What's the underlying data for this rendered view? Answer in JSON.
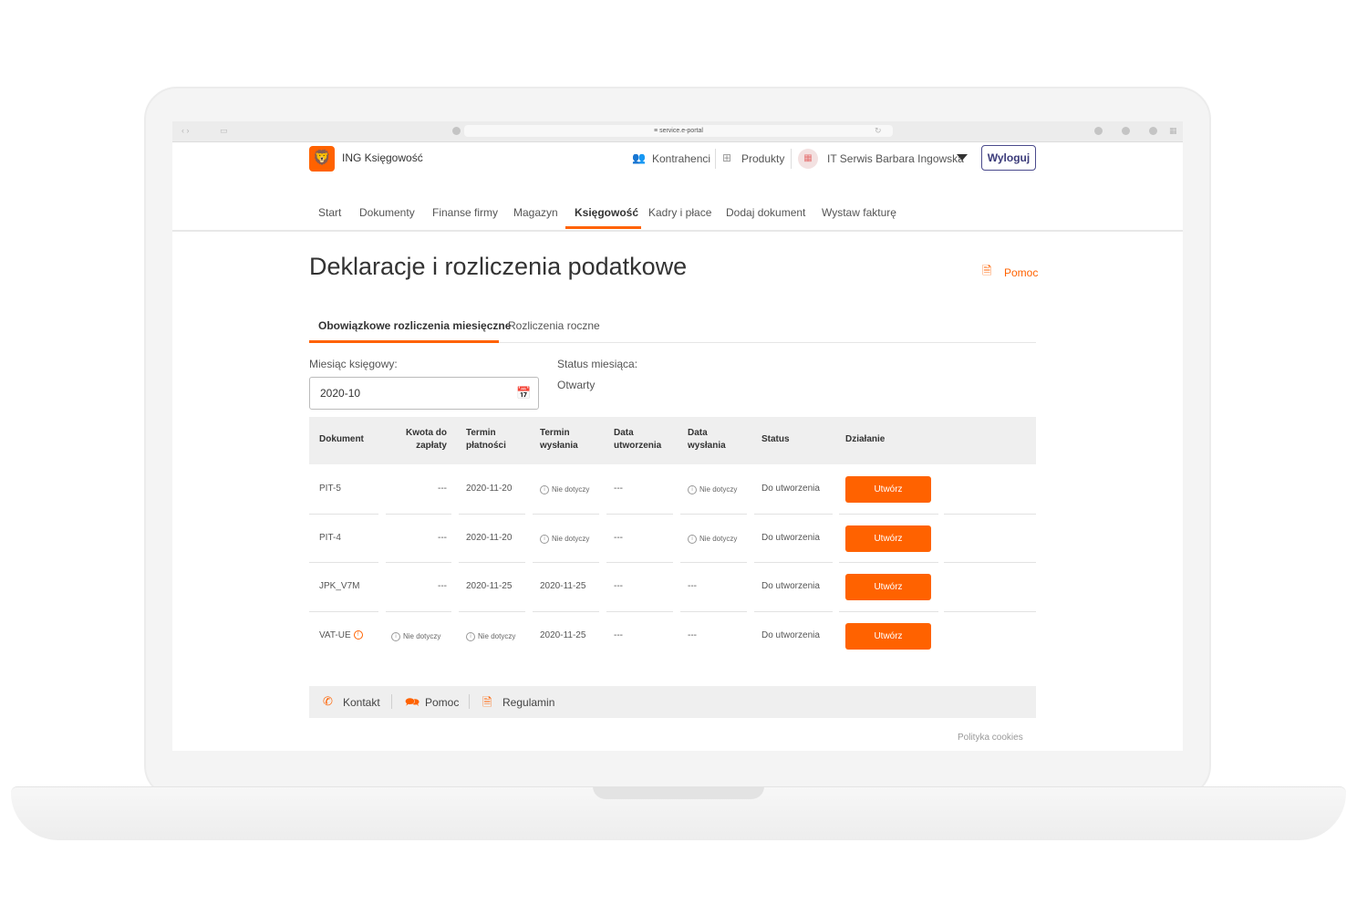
{
  "browser": {
    "url": "≡ service.e-portal"
  },
  "header": {
    "logo_glyph": "🦁",
    "brand": "ING Księgowość",
    "contractors": "Kontrahenci",
    "products": "Produkty",
    "company": "IT Serwis Barbara Ingowska",
    "logout": "Wyloguj"
  },
  "nav": [
    "Start",
    "Dokumenty",
    "Finanse firmy",
    "Magazyn",
    "Księgowość",
    "Kadry i płace",
    "Dodaj dokument",
    "Wystaw fakturę"
  ],
  "page": {
    "title": "Deklaracje i rozliczenia podatkowe",
    "help": "Pomoc",
    "tabs": [
      "Obowiązkowe rozliczenia miesięczne",
      "Rozliczenia roczne"
    ],
    "month_label": "Miesiąc księgowy:",
    "month_value": "2020-10",
    "status_label": "Status miesiąca:",
    "status_value": "Otwarty"
  },
  "table": {
    "headers": {
      "document": "Dokument",
      "amount_1": "Kwota do",
      "amount_2": "zapłaty",
      "due_1": "Termin",
      "due_2": "płatności",
      "send_1": "Termin",
      "send_2": "wysłania",
      "created_1": "Data",
      "created_2": "utworzenia",
      "sent_1": "Data",
      "sent_2": "wysłania",
      "status": "Status",
      "action": "Działanie"
    },
    "rows": [
      {
        "doc": "PIT-5",
        "amount": "---",
        "due": "2020-11-20",
        "send": "Nie dotyczy",
        "created": "---",
        "sent": "Nie dotyczy",
        "status": "Do utworzenia",
        "action": "Utwórz"
      },
      {
        "doc": "PIT-4",
        "amount": "---",
        "due": "2020-11-20",
        "send": "Nie dotyczy",
        "created": "---",
        "sent": "Nie dotyczy",
        "status": "Do utworzenia",
        "action": "Utwórz"
      },
      {
        "doc": "JPK_V7M",
        "amount": "---",
        "due": "2020-11-25",
        "send": "2020-11-25",
        "created": "---",
        "sent": "---",
        "status": "Do utworzenia",
        "action": "Utwórz"
      },
      {
        "doc": "VAT-UE",
        "amount": "Nie dotyczy",
        "due": "Nie dotyczy",
        "send": "2020-11-25",
        "created": "---",
        "sent": "---",
        "status": "Do utworzenia",
        "action": "Utwórz"
      }
    ]
  },
  "footer": {
    "contact": "Kontakt",
    "help": "Pomoc",
    "terms": "Regulamin",
    "cookies": "Polityka cookies"
  },
  "colors": {
    "accent": "#ff6200",
    "logout": "#3b3b7a"
  }
}
